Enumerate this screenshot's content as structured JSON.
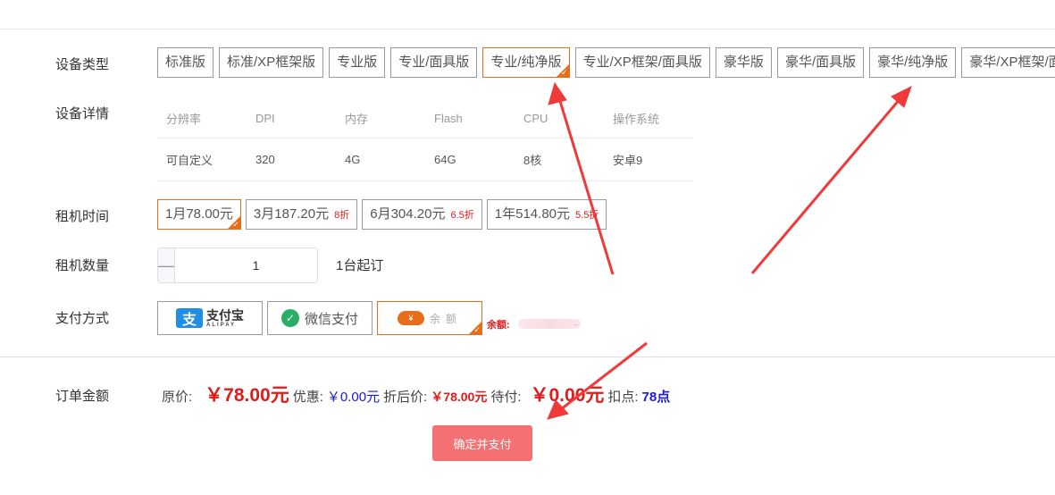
{
  "device_type": {
    "label": "设备类型",
    "options": [
      "标准版",
      "标准/XP框架版",
      "专业版",
      "专业/面具版",
      "专业/纯净版",
      "专业/XP框架/面具版",
      "豪华版",
      "豪华/面具版",
      "豪华/纯净版",
      "豪华/XP框架/面具版"
    ],
    "selected": "专业/纯净版"
  },
  "device_details": {
    "label": "设备详情",
    "headers": [
      "分辨率",
      "DPI",
      "内存",
      "Flash",
      "CPU",
      "操作系统"
    ],
    "values": [
      "可自定义",
      "320",
      "4G",
      "64G",
      "8核",
      "安卓9"
    ]
  },
  "rental_period": {
    "label": "租机时间",
    "options": [
      {
        "label": "1月78.00元",
        "discount": ""
      },
      {
        "label": "3月187.20元",
        "discount": "8折"
      },
      {
        "label": "6月304.20元",
        "discount": "6.5折"
      },
      {
        "label": "1年514.80元",
        "discount": "5.5折"
      }
    ],
    "selected": "1月78.00元"
  },
  "quantity": {
    "label": "租机数量",
    "value": "1",
    "minus_icon": "minus-icon",
    "plus_icon": "plus-icon",
    "note": "1台起订"
  },
  "payment": {
    "label": "支付方式",
    "methods": [
      {
        "name": "alipay",
        "logo_glyph": "支",
        "text": "支付宝",
        "sub": "ALIPAY"
      },
      {
        "name": "wechat",
        "logo_glyph": "✓",
        "text": "微信支付"
      },
      {
        "name": "balance",
        "logo_glyph": "¥",
        "text": "余额"
      }
    ],
    "selected": "balance",
    "balance_label": "余额:",
    "balance_trailing": ".."
  },
  "order": {
    "label": "订单金额",
    "original_label": "原价:",
    "original_value": "￥78.00元",
    "discount_label": "优惠:",
    "discount_value": "￥0.00元",
    "after_label": "折后价:",
    "after_value": "￥78.00元",
    "due_label": "待付:",
    "due_value": "￥0.00元",
    "points_label": "扣点:",
    "points_value": "78点"
  },
  "confirm_button": "确定并支付",
  "colors": {
    "selected_border": "#e86d1a",
    "price_red": "#e21a1a",
    "link_blue": "#1a1ae0",
    "confirm_bg": "#f47173",
    "annotation_arrow": "#f03a3a"
  }
}
